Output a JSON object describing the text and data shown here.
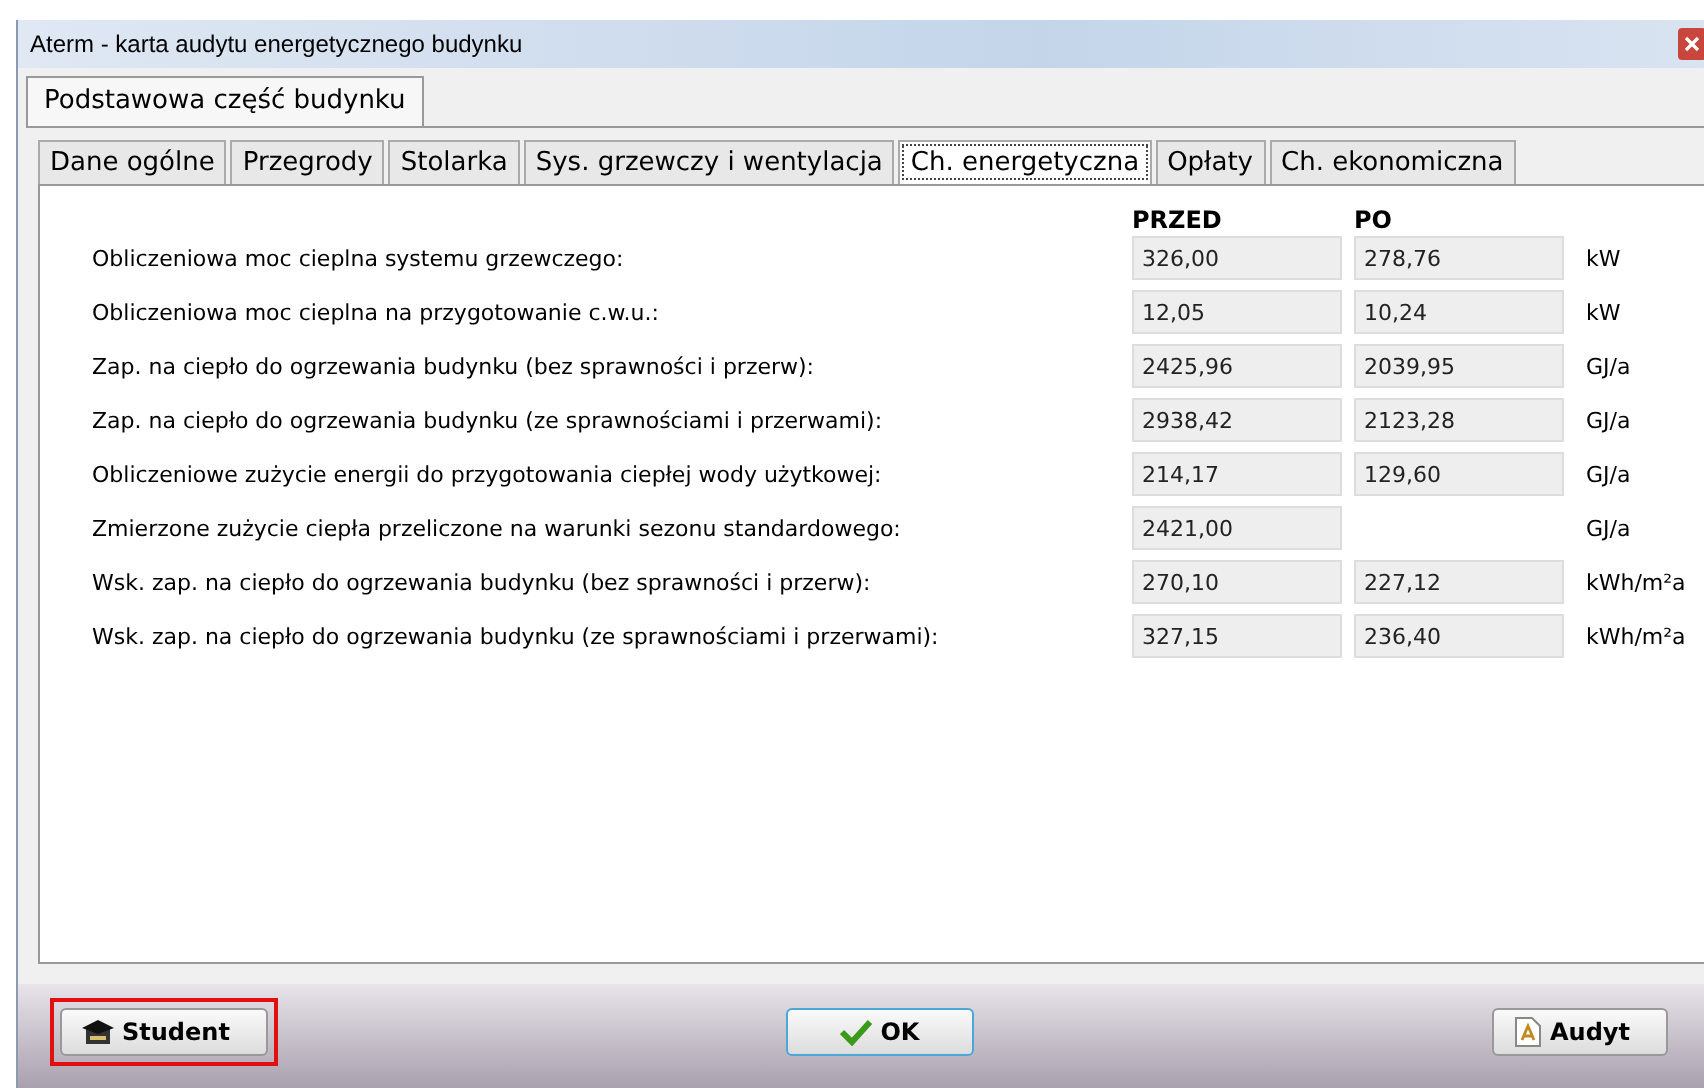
{
  "window": {
    "title": "Aterm - karta audytu energetycznego budynku"
  },
  "outer_tabs": [
    {
      "label": "Podstawowa część budynku",
      "selected": true
    }
  ],
  "tabs": [
    {
      "label": "Dane ogólne",
      "selected": false
    },
    {
      "label": "Przegrody",
      "selected": false
    },
    {
      "label": "Stolarka",
      "selected": false
    },
    {
      "label": "Sys. grzewczy i wentylacja",
      "selected": false
    },
    {
      "label": "Ch. energetyczna",
      "selected": true
    },
    {
      "label": "Opłaty",
      "selected": false
    },
    {
      "label": "Ch. ekonomiczna",
      "selected": false
    }
  ],
  "columns": [
    "PRZED",
    "PO"
  ],
  "rows": [
    {
      "label": "Obliczeniowa moc cieplna systemu grzewczego:",
      "before": "326,00",
      "after": "278,76",
      "unit": "kW"
    },
    {
      "label": "Obliczeniowa moc cieplna na przygotowanie c.w.u.:",
      "before": "12,05",
      "after": "10,24",
      "unit": "kW"
    },
    {
      "label": "Zap. na ciepło do ogrzewania budynku (bez sprawności i przerw):",
      "before": "2425,96",
      "after": "2039,95",
      "unit": "GJ/a"
    },
    {
      "label": "Zap. na ciepło do ogrzewania budynku (ze sprawnościami i przerwami):",
      "before": "2938,42",
      "after": "2123,28",
      "unit": "GJ/a"
    },
    {
      "label": "Obliczeniowe zużycie energii do przygotowania ciepłej wody użytkowej:",
      "before": "214,17",
      "after": "129,60",
      "unit": "GJ/a"
    },
    {
      "label": "Zmierzone zużycie ciepła przeliczone na warunki sezonu standardowego:",
      "before": "2421,00",
      "unit": "GJ/a"
    },
    {
      "label": "Wsk. zap. na ciepło do ogrzewania budynku (bez sprawności i przerw):",
      "before": "270,10",
      "after": "227,12",
      "unit": "kWh/m²a"
    },
    {
      "label": "Wsk. zap. na ciepło do ogrzewania budynku (ze sprawnościami i przerwami):",
      "before": "327,15",
      "after": "236,40",
      "unit": "kWh/m²a"
    }
  ],
  "buttons": [
    {
      "label": "Student",
      "kind": "student",
      "highlighted": true
    },
    {
      "label": "OK",
      "kind": "ok",
      "highlighted": false
    },
    {
      "label": "Audyt",
      "kind": "audit",
      "highlighted": false
    }
  ]
}
